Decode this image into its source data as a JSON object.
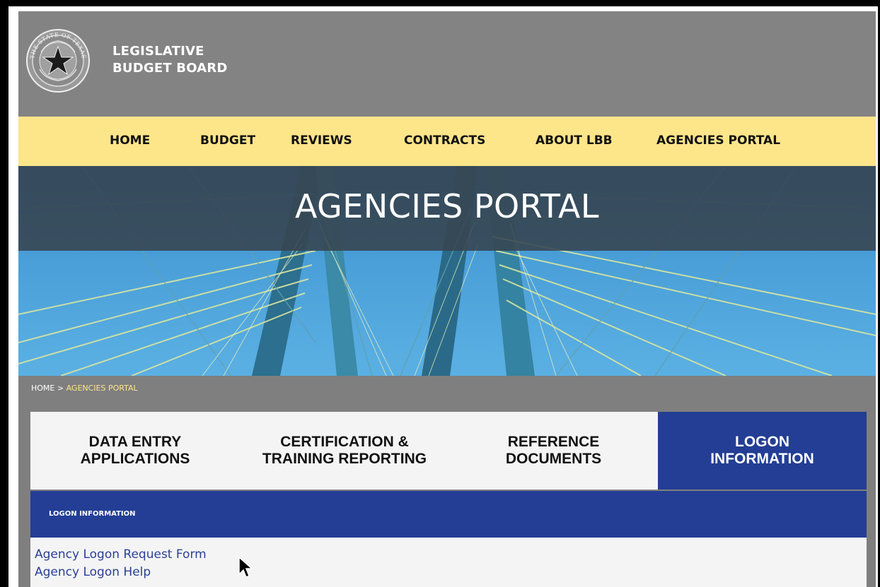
{
  "header": {
    "brand_line1": "LEGISLATIVE",
    "brand_line2": "BUDGET BOARD",
    "seal_icon": "state-of-texas-seal",
    "seal_text": "THE STATE OF TEXAS"
  },
  "nav": {
    "items": [
      {
        "label": "HOME"
      },
      {
        "label": "BUDGET"
      },
      {
        "label": "REVIEWS"
      },
      {
        "label": "CONTRACTS"
      },
      {
        "label": "ABOUT LBB"
      },
      {
        "label": "AGENCIES PORTAL"
      }
    ]
  },
  "hero": {
    "title": "AGENCIES PORTAL"
  },
  "breadcrumb": {
    "home": "HOME",
    "separator": " > ",
    "current": "AGENCIES PORTAL"
  },
  "tabs": [
    {
      "line1": "DATA ENTRY",
      "line2": "APPLICATIONS",
      "active": false
    },
    {
      "line1": "CERTIFICATION &",
      "line2": "TRAINING REPORTING",
      "active": false
    },
    {
      "line1": "REFERENCE",
      "line2": "DOCUMENTS",
      "active": false
    },
    {
      "line1": "LOGON",
      "line2": "INFORMATION",
      "active": true
    }
  ],
  "section": {
    "title": "LOGON INFORMATION"
  },
  "links": [
    {
      "label": "Agency Logon Request Form"
    },
    {
      "label": "Agency Logon Help"
    }
  ],
  "colors": {
    "header_bg": "#838383",
    "nav_bg": "#fde58a",
    "active_tab": "#233e94",
    "breadcrumb_current": "#fde58a",
    "link": "#2b3f96"
  }
}
